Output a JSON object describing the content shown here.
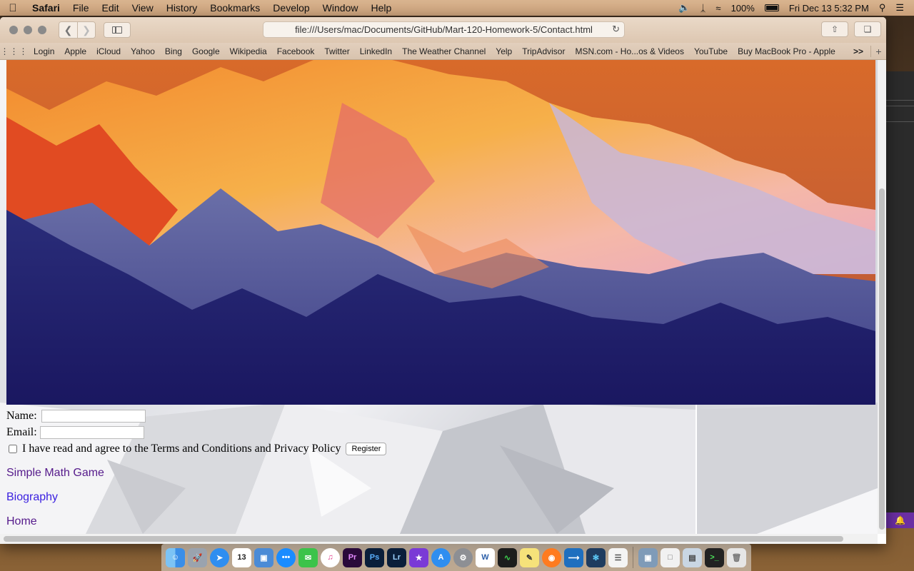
{
  "menubar": {
    "app_name": "Safari",
    "items": [
      "File",
      "Edit",
      "View",
      "History",
      "Bookmarks",
      "Develop",
      "Window",
      "Help"
    ],
    "battery": "100%",
    "datetime": "Fri Dec 13  5:32 PM"
  },
  "browser": {
    "url": "file:///Users/mac/Documents/GitHub/Mart-120-Homework-5/Contact.html",
    "favorites": [
      "Login",
      "Apple",
      "iCloud",
      "Yahoo",
      "Bing",
      "Google",
      "Wikipedia",
      "Facebook",
      "Twitter",
      "LinkedIn",
      "The Weather Channel",
      "Yelp",
      "TripAdvisor",
      "MSN.com - Ho...os & Videos",
      "YouTube",
      "Buy MacBook Pro - Apple"
    ],
    "more_label": ">>",
    "add_label": "+"
  },
  "page": {
    "form": {
      "name_label": "Name:",
      "email_label": "Email:",
      "agree_label": "I have read and agree to the Terms and Conditions and Privacy Policy",
      "register_label": "Register",
      "name_value": "",
      "email_value": ""
    },
    "links": [
      "Simple Math Game",
      "Biography",
      "Home"
    ]
  },
  "dock": {
    "calendar_day": "13",
    "apps": [
      "Finder",
      "Launchpad",
      "Safari",
      "Calendar",
      "Preview",
      "Messenger",
      "Messages",
      "iTunes",
      "Premiere Pro",
      "Photoshop",
      "Lightroom",
      "iMovie",
      "App Store",
      "System Preferences",
      "Word",
      "Activity Monitor",
      "Stickies",
      "Firefox",
      "VS Code",
      "Sourcetree",
      "TextEdit",
      "Screen",
      "Folder",
      "Preview",
      "Terminal",
      "Trash"
    ]
  }
}
